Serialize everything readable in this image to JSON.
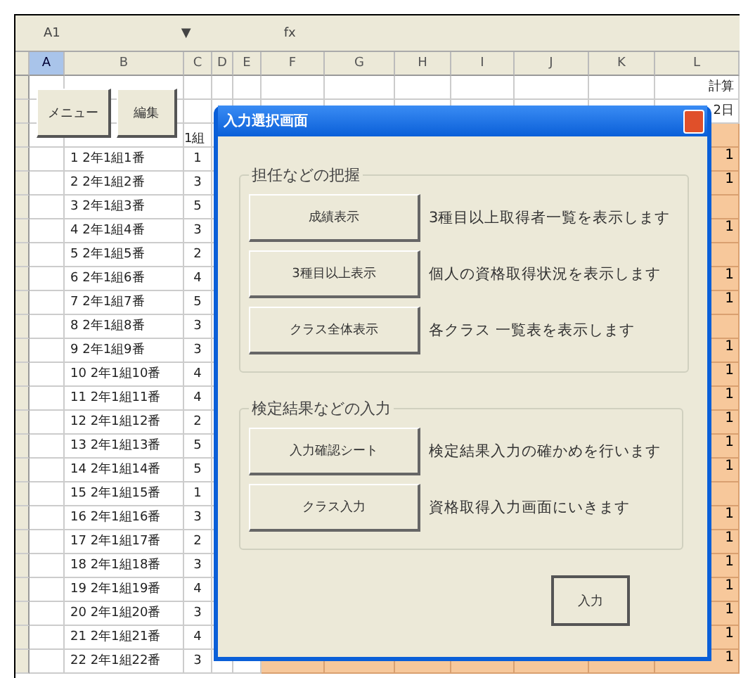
{
  "formula_bar": {
    "name_box": "A1",
    "dropdown": "▼",
    "fx": "fx"
  },
  "columns": [
    {
      "label": "A",
      "selected": true
    },
    {
      "label": "B",
      "selected": false
    },
    {
      "label": "C",
      "selected": false
    },
    {
      "label": "D",
      "selected": false
    },
    {
      "label": "E",
      "selected": false
    },
    {
      "label": "F",
      "selected": false
    },
    {
      "label": "G",
      "selected": false
    },
    {
      "label": "H",
      "selected": false
    },
    {
      "label": "I",
      "selected": false
    },
    {
      "label": "J",
      "selected": false
    },
    {
      "label": "K",
      "selected": false
    },
    {
      "label": "L",
      "selected": false
    }
  ],
  "sheet_buttons": [
    "メニュー",
    "編集"
  ],
  "header_cells": {
    "c": "1組",
    "l_top": "計算",
    "l_bottom": "2日"
  },
  "rows": [
    {
      "name": "1 2年1組1番",
      "c": "1",
      "l": "1"
    },
    {
      "name": "2 2年1組2番",
      "c": "3",
      "l": "1"
    },
    {
      "name": "3 2年1組3番",
      "c": "5",
      "l": ""
    },
    {
      "name": "4 2年1組4番",
      "c": "3",
      "l": "1"
    },
    {
      "name": "5 2年1組5番",
      "c": "2",
      "l": ""
    },
    {
      "name": "6 2年1組6番",
      "c": "4",
      "l": "1"
    },
    {
      "name": "7 2年1組7番",
      "c": "5",
      "l": "1"
    },
    {
      "name": "8 2年1組8番",
      "c": "3",
      "l": ""
    },
    {
      "name": "9 2年1組9番",
      "c": "3",
      "l": "1"
    },
    {
      "name": "10 2年1組10番",
      "c": "4",
      "l": "1"
    },
    {
      "name": "11 2年1組11番",
      "c": "4",
      "l": "1"
    },
    {
      "name": "12 2年1組12番",
      "c": "2",
      "l": "1"
    },
    {
      "name": "13 2年1組13番",
      "c": "5",
      "l": "1"
    },
    {
      "name": "14 2年1組14番",
      "c": "5",
      "l": "1"
    },
    {
      "name": "15 2年1組15番",
      "c": "1",
      "l": ""
    },
    {
      "name": "16 2年1組16番",
      "c": "3",
      "l": "1"
    },
    {
      "name": "17 2年1組17番",
      "c": "2",
      "l": "1"
    },
    {
      "name": "18 2年1組18番",
      "c": "3",
      "l": "1"
    },
    {
      "name": "19 2年1組19番",
      "c": "4",
      "l": "1"
    },
    {
      "name": "20 2年1組20番",
      "c": "3",
      "l": "1"
    },
    {
      "name": "21 2年1組21番",
      "c": "4",
      "l": "1"
    },
    {
      "name": "22 2年1組22番",
      "c": "3",
      "l": "1"
    }
  ],
  "dialog": {
    "title": "入力選択画面",
    "groups": [
      {
        "title": "担任などの把握",
        "items": [
          {
            "button": "成績表示",
            "description": "3種目以上取得者一覧を表示します"
          },
          {
            "button": "3種目以上表示",
            "description": "個人の資格取得状況を表示します"
          },
          {
            "button": "クラス全体表示",
            "description": "各クラス 一覧表を表示します"
          }
        ]
      },
      {
        "title": "検定結果などの入力",
        "items": [
          {
            "button": "入力確認シート",
            "description": "検定結果入力の確かめを行います"
          },
          {
            "button": "クラス入力",
            "description": "資格取得入力画面にいきます"
          }
        ]
      }
    ],
    "ok_button": "入力"
  }
}
